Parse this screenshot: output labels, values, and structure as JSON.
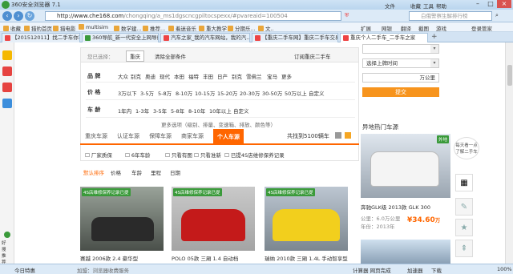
{
  "window": {
    "title": "360安全浏览器 7.1"
  },
  "address": {
    "domain": "http://www.che168.com",
    "path": "/chongqing/a_ms1dgscncgpiltocspexx/#pvareaid=100504"
  },
  "search": {
    "placeholder": "白俄警察生解排行榜"
  },
  "bookmarks": [
    "收藏",
    "猎豹首页",
    "猎电影",
    "multisim",
    "数学建...",
    "推荐...",
    "着迷音乐",
    "重大教学",
    "分期乐...",
    "文.."
  ],
  "toolbar_right": [
    "文件",
    "查看",
    "收藏",
    "工具",
    "帮助"
  ],
  "nav_right": [
    "扩展",
    "网银",
    "翻译",
    "截图",
    "游戏",
    "登录管家"
  ],
  "tabs": [
    {
      "label": "【201512011】找二手车你不懂不..."
    },
    {
      "label": "360导航_新一代安全上网导航"
    },
    {
      "label": "汽车之家_我的汽车网站，我的汽..."
    },
    {
      "label": "【重庆二手车网】重庆二手车交易..."
    },
    {
      "label": "重庆个人二手车_二手车之家"
    }
  ],
  "filters": {
    "chosen_label": "您已选择：",
    "chosen_tag": "重庆",
    "clear_label": "清除全部条件",
    "subscribe_label": "订阅重庆二手车",
    "brand_label": "品  牌",
    "brands": [
      "大众",
      "别克",
      "奥迪",
      "现代",
      "本田",
      "福特",
      "丰田",
      "日产",
      "别克",
      "雪佛兰",
      "宝马",
      "更多"
    ],
    "price_label": "价  格",
    "prices": [
      "3万以下",
      "3-5万",
      "5-8万",
      "8-10万",
      "10-15万",
      "15-20万",
      "20-30万",
      "30-50万",
      "50万以上",
      "自定义"
    ],
    "age_label": "车  龄",
    "ages": [
      "1年内",
      "1-3年",
      "3-5年",
      "5-8年",
      "8-10年",
      "10年以上",
      "自定义"
    ],
    "more_label": "更多选项（级别、排量、变速箱、排放、颜色等）"
  },
  "result_tabs": [
    "重庆车源",
    "认证车源",
    "保障车源",
    "商家车源",
    "个人车源"
  ],
  "result_count": "共找到5100辆车",
  "checkboxes": [
    "厂家质保",
    "6年车龄",
    "只看有图",
    "只看准新",
    "已提4S店维修保养记录"
  ],
  "sort": [
    "默认排序",
    "价格",
    "车龄",
    "里程",
    "日期"
  ],
  "cars": [
    {
      "title": "赛越 2006款 2.4 豪华型",
      "badge": "4S店维修保养记录已提"
    },
    {
      "title": "POLO 05款 三厢 1.4 自动档",
      "badge": "4S店维修保养记录已提"
    },
    {
      "title": "瑞纳 2010款 三厢 1.4L 手动智享型",
      "badge": "4S店维修保养记录已提"
    }
  ],
  "right_panel": {
    "time_select": "选择上牌时间",
    "km_label": "万公里",
    "submit": "提交",
    "hot_title": "异地热门车源",
    "hot_car": {
      "title": "奔驰GLK级 2013款 GLK 300",
      "mileage": "公里：6.0万公里",
      "year": "年份：2013年",
      "price": "¥34.60",
      "unit": "万",
      "tag": "外地"
    },
    "popup": "每天看一点了解二手车"
  },
  "statusbar": {
    "left": "今日特惠",
    "items": [
      "加速器",
      "下载",
      "100%"
    ],
    "bottom_link": "加盟：浏览器收费服务",
    "right_misc": "计算器 网页完成"
  }
}
